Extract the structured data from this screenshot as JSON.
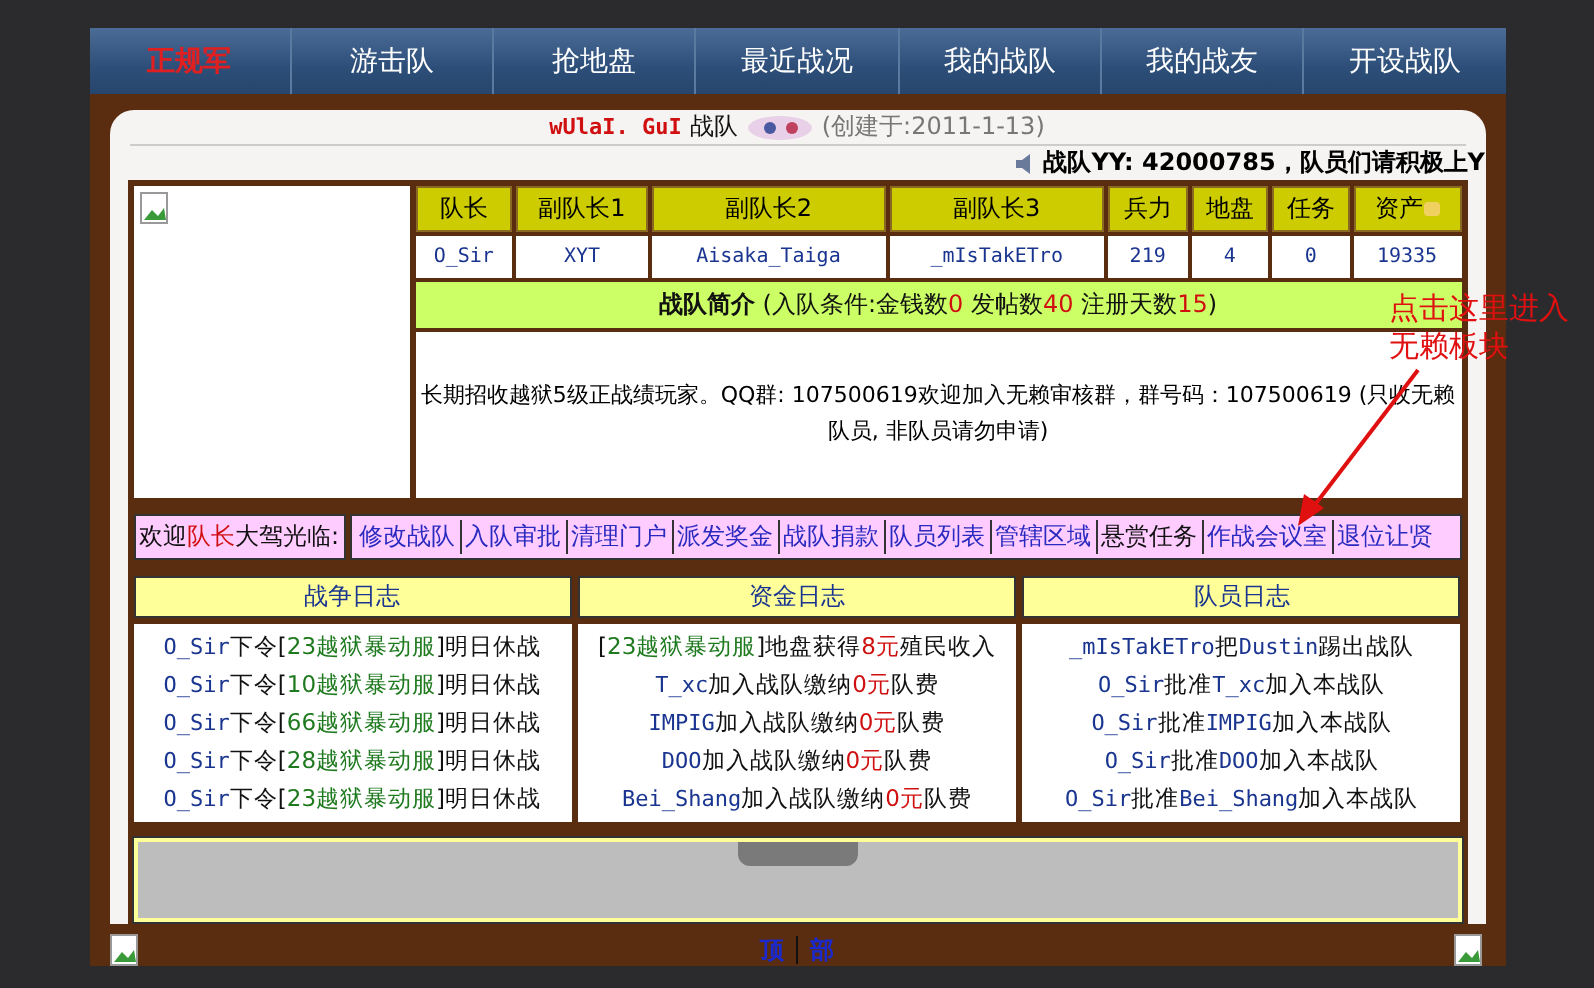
{
  "nav": [
    {
      "label": "正规军",
      "selected": true
    },
    {
      "label": "游击队",
      "selected": false
    },
    {
      "label": "抢地盘",
      "selected": false
    },
    {
      "label": "最近战况",
      "selected": false
    },
    {
      "label": "我的战队",
      "selected": false
    },
    {
      "label": "我的战友",
      "selected": false
    },
    {
      "label": "开设战队",
      "selected": false
    }
  ],
  "header": {
    "team_name": "wUlaI. GuI",
    "team_suffix": "战队",
    "created": "(创建于:2011-1-13)",
    "announcement": "战队YY: 42000785，队员们请积极上Y"
  },
  "team_table": {
    "columns": [
      "队长",
      "副队长1",
      "副队长2",
      "副队长3",
      "兵力",
      "地盘",
      "任务",
      "资产"
    ],
    "values": [
      "O_Sir",
      "XYT",
      "Aisaka_Taiga",
      "_mIsTakETro",
      "219",
      "4",
      "0",
      "19335"
    ],
    "intro": [
      {
        "text": "战队简介",
        "kind": "bold"
      },
      {
        "text": " (入队条件:金钱数",
        "kind": "plain"
      },
      {
        "text": "0",
        "kind": "money"
      },
      {
        "text": " 发帖数",
        "kind": "plain"
      },
      {
        "text": "40",
        "kind": "money"
      },
      {
        "text": " 注册天数",
        "kind": "plain"
      },
      {
        "text": "15",
        "kind": "money"
      },
      {
        "text": ")",
        "kind": "plain"
      }
    ],
    "description": "长期招收越狱5级正战绩玩家。QQ群: 107500619欢迎加入无赖审核群，群号码：107500619 (只收无赖队员, 非队员请勿申请)"
  },
  "admin_bar": {
    "greeting": [
      {
        "text": "欢迎",
        "kind": "plain"
      },
      {
        "text": "队长",
        "kind": "money"
      },
      {
        "text": "大驾光临:",
        "kind": "plain"
      }
    ],
    "links": [
      {
        "label": "修改战队",
        "kind": "link"
      },
      {
        "label": "入队审批",
        "kind": "link"
      },
      {
        "label": "清理门户",
        "kind": "link"
      },
      {
        "label": "派发奖金",
        "kind": "link"
      },
      {
        "label": "战队捐款",
        "kind": "link"
      },
      {
        "label": "队员列表",
        "kind": "link"
      },
      {
        "label": "管辖区域",
        "kind": "link"
      },
      {
        "label": "悬赏任务",
        "kind": "plain"
      },
      {
        "label": "作战会议室",
        "kind": "link"
      },
      {
        "label": "退位让贤",
        "kind": "link"
      }
    ]
  },
  "annotation": "点击这里进入无赖板块",
  "logs": [
    {
      "title": "战争日志",
      "rows": [
        {
          "parts": [
            {
              "text": "O_Sir",
              "kind": "name"
            },
            {
              "text": "下令[",
              "kind": "plain"
            },
            {
              "text": "23越狱暴动服",
              "kind": "server"
            },
            {
              "text": "]明日休战",
              "kind": "plain"
            }
          ]
        },
        {
          "parts": [
            {
              "text": "O_Sir",
              "kind": "name"
            },
            {
              "text": "下令[",
              "kind": "plain"
            },
            {
              "text": "10越狱暴动服",
              "kind": "server"
            },
            {
              "text": "]明日休战",
              "kind": "plain"
            }
          ]
        },
        {
          "parts": [
            {
              "text": "O_Sir",
              "kind": "name"
            },
            {
              "text": "下令[",
              "kind": "plain"
            },
            {
              "text": "66越狱暴动服",
              "kind": "server"
            },
            {
              "text": "]明日休战",
              "kind": "plain"
            }
          ]
        },
        {
          "parts": [
            {
              "text": "O_Sir",
              "kind": "name"
            },
            {
              "text": "下令[",
              "kind": "plain"
            },
            {
              "text": "28越狱暴动服",
              "kind": "server"
            },
            {
              "text": "]明日休战",
              "kind": "plain"
            }
          ]
        },
        {
          "parts": [
            {
              "text": "O_Sir",
              "kind": "name"
            },
            {
              "text": "下令[",
              "kind": "plain"
            },
            {
              "text": "23越狱暴动服",
              "kind": "server"
            },
            {
              "text": "]明日休战",
              "kind": "plain"
            }
          ]
        }
      ]
    },
    {
      "title": "资金日志",
      "rows": [
        {
          "parts": [
            {
              "text": "[",
              "kind": "plain"
            },
            {
              "text": "23越狱暴动服",
              "kind": "server"
            },
            {
              "text": "]地盘获得",
              "kind": "plain"
            },
            {
              "text": "8元",
              "kind": "money"
            },
            {
              "text": "殖民收入",
              "kind": "plain"
            }
          ]
        },
        {
          "parts": [
            {
              "text": "T_xc",
              "kind": "name"
            },
            {
              "text": "加入战队缴纳",
              "kind": "plain"
            },
            {
              "text": "0元",
              "kind": "money"
            },
            {
              "text": "队费",
              "kind": "plain"
            }
          ]
        },
        {
          "parts": [
            {
              "text": "IMPIG",
              "kind": "name"
            },
            {
              "text": "加入战队缴纳",
              "kind": "plain"
            },
            {
              "text": "0元",
              "kind": "money"
            },
            {
              "text": "队费",
              "kind": "plain"
            }
          ]
        },
        {
          "parts": [
            {
              "text": "DOO",
              "kind": "name"
            },
            {
              "text": "加入战队缴纳",
              "kind": "plain"
            },
            {
              "text": "0元",
              "kind": "money"
            },
            {
              "text": "队费",
              "kind": "plain"
            }
          ]
        },
        {
          "parts": [
            {
              "text": "Bei_Shang",
              "kind": "name"
            },
            {
              "text": "加入战队缴纳",
              "kind": "plain"
            },
            {
              "text": "0元",
              "kind": "money"
            },
            {
              "text": "队费",
              "kind": "plain"
            }
          ]
        }
      ]
    },
    {
      "title": "队员日志",
      "rows": [
        {
          "parts": [
            {
              "text": "_mIsTakETro",
              "kind": "name"
            },
            {
              "text": "把",
              "kind": "plain"
            },
            {
              "text": "Dustin",
              "kind": "name"
            },
            {
              "text": "踢出战队",
              "kind": "plain"
            }
          ]
        },
        {
          "parts": [
            {
              "text": "O_Sir",
              "kind": "name"
            },
            {
              "text": "批准",
              "kind": "plain"
            },
            {
              "text": "T_xc",
              "kind": "name"
            },
            {
              "text": "加入本战队",
              "kind": "plain"
            }
          ]
        },
        {
          "parts": [
            {
              "text": "O_Sir",
              "kind": "name"
            },
            {
              "text": "批准",
              "kind": "plain"
            },
            {
              "text": "IMPIG",
              "kind": "name"
            },
            {
              "text": "加入本战队",
              "kind": "plain"
            }
          ]
        },
        {
          "parts": [
            {
              "text": "O_Sir",
              "kind": "name"
            },
            {
              "text": "批准",
              "kind": "plain"
            },
            {
              "text": "DOO",
              "kind": "name"
            },
            {
              "text": "加入本战队",
              "kind": "plain"
            }
          ]
        },
        {
          "parts": [
            {
              "text": "O_Sir",
              "kind": "name"
            },
            {
              "text": "批准",
              "kind": "plain"
            },
            {
              "text": "Bei_Shang",
              "kind": "name"
            },
            {
              "text": "加入本战队",
              "kind": "plain"
            }
          ]
        }
      ]
    }
  ],
  "footer_links": [
    "顶",
    "部"
  ]
}
